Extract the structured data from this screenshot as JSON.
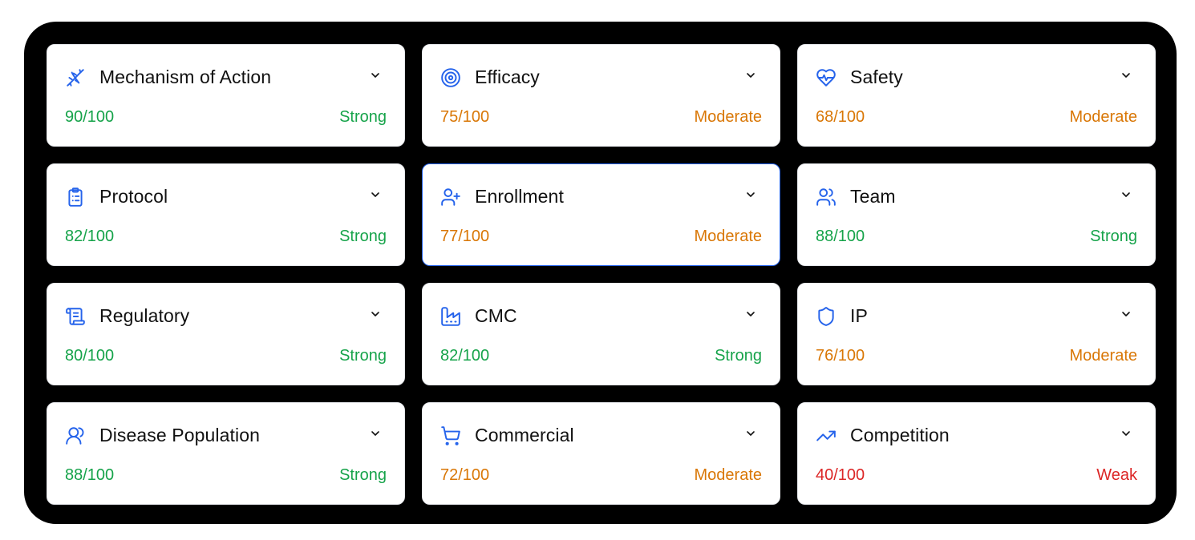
{
  "colors": {
    "strong": "#16a34a",
    "moderate": "#d97706",
    "weak": "#dc2626",
    "accent": "#2563eb"
  },
  "cards": [
    {
      "title": "Mechanism of Action",
      "score": "90/100",
      "rating": "Strong",
      "icon": "dna-icon"
    },
    {
      "title": "Efficacy",
      "score": "75/100",
      "rating": "Moderate",
      "icon": "target-icon"
    },
    {
      "title": "Safety",
      "score": "68/100",
      "rating": "Moderate",
      "icon": "heart-pulse-icon"
    },
    {
      "title": "Protocol",
      "score": "82/100",
      "rating": "Strong",
      "icon": "clipboard-list-icon"
    },
    {
      "title": "Enrollment",
      "score": "77/100",
      "rating": "Moderate",
      "icon": "user-plus-icon"
    },
    {
      "title": "Team",
      "score": "88/100",
      "rating": "Strong",
      "icon": "users-icon"
    },
    {
      "title": "Regulatory",
      "score": "80/100",
      "rating": "Strong",
      "icon": "scroll-icon"
    },
    {
      "title": "CMC",
      "score": "82/100",
      "rating": "Strong",
      "icon": "factory-icon"
    },
    {
      "title": "IP",
      "score": "76/100",
      "rating": "Moderate",
      "icon": "shield-icon"
    },
    {
      "title": "Disease Population",
      "score": "88/100",
      "rating": "Strong",
      "icon": "users-round-icon"
    },
    {
      "title": "Commercial",
      "score": "72/100",
      "rating": "Moderate",
      "icon": "shopping-cart-icon"
    },
    {
      "title": "Competition",
      "score": "40/100",
      "rating": "Weak",
      "icon": "trending-up-icon"
    }
  ]
}
